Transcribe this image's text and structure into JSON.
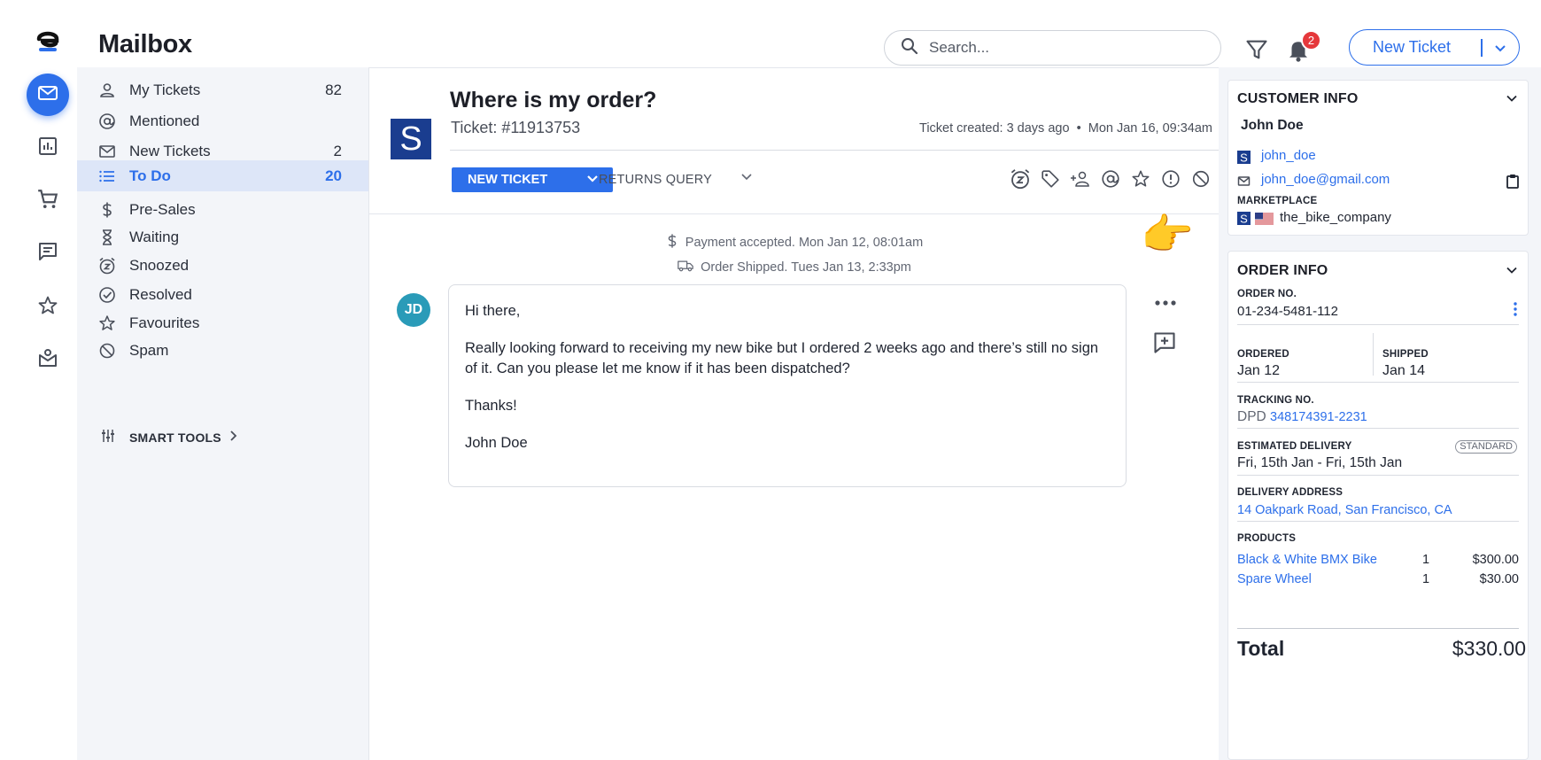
{
  "app": {
    "title": "Mailbox",
    "brand_color": "#2d6fea",
    "logo_icon": "brand-e-logo"
  },
  "rail": {
    "items": [
      {
        "icon": "mail-icon",
        "active": true
      },
      {
        "icon": "analytics-icon",
        "active": false
      },
      {
        "icon": "cart-icon",
        "active": false
      },
      {
        "icon": "chat-icon",
        "active": false
      },
      {
        "icon": "star-icon",
        "active": false
      },
      {
        "icon": "inbox-user-icon",
        "active": false
      }
    ]
  },
  "header": {
    "search_placeholder": "Search...",
    "notification_count": "2",
    "new_ticket_label": "New Ticket"
  },
  "nav": {
    "items": [
      {
        "label": "My Tickets",
        "count": "82",
        "icon": "user-icon"
      },
      {
        "label": "Mentioned",
        "count": "",
        "icon": "at-icon"
      },
      {
        "label": "New Tickets",
        "count": "2",
        "icon": "envelope-icon"
      },
      {
        "label": "To Do",
        "count": "20",
        "icon": "list-icon",
        "active": true
      },
      {
        "label": "Pre-Sales",
        "count": "",
        "icon": "dollar-icon"
      },
      {
        "label": "Waiting",
        "count": "",
        "icon": "hourglass-icon"
      },
      {
        "label": "Snoozed",
        "count": "",
        "icon": "snooze-icon"
      },
      {
        "label": "Resolved",
        "count": "",
        "icon": "check-circle-icon"
      },
      {
        "label": "Favourites",
        "count": "",
        "icon": "star-icon"
      },
      {
        "label": "Spam",
        "count": "",
        "icon": "block-icon"
      }
    ],
    "smart_tools_label": "SMART TOOLS"
  },
  "ticket": {
    "store_logo_letter": "S",
    "subject": "Where is my order?",
    "number": "Ticket: #11913753",
    "created": "Ticket created: 3 days ago",
    "created_date": "Mon Jan 16, 09:34am",
    "status_label": "NEW TICKET",
    "tag_label": "RETURNS QUERY",
    "actions": [
      "snooze-icon",
      "tag-icon",
      "assign-user-icon",
      "mention-icon",
      "favourite-icon",
      "alert-icon",
      "spam-icon"
    ]
  },
  "timeline": {
    "events": [
      {
        "icon": "dollar-icon",
        "text": "Payment accepted. Mon Jan 12, 08:01am"
      },
      {
        "icon": "truck-icon",
        "text": "Order Shipped. Tues Jan 13, 2:33pm"
      }
    ]
  },
  "message": {
    "avatar_initials": "JD",
    "paragraphs": [
      "Hi there,",
      "Really looking forward to receiving my new bike but I ordered 2 weeks ago and there’s still no sign of it. Can you please let me know if it has been dispatched?",
      "Thanks!",
      "John Doe"
    ]
  },
  "customer_info": {
    "title": "CUSTOMER INFO",
    "name": "John Doe",
    "username": "john_doe",
    "email": "john_doe@gmail.com",
    "marketplace_label": "MARKETPLACE",
    "marketplace": "the_bike_company"
  },
  "order_info": {
    "title": "ORDER INFO",
    "order_no_label": "ORDER NO.",
    "order_no": "01-234-5481-112",
    "ordered_label": "ORDERED",
    "ordered": "Jan 12",
    "shipped_label": "SHIPPED",
    "shipped": "Jan 14",
    "tracking_label": "TRACKING NO.",
    "carrier": "DPD",
    "tracking_no": "348174391-2231",
    "est_delivery_label": "ESTIMATED DELIVERY",
    "est_delivery": "Fri, 15th Jan - Fri, 15th Jan",
    "shipping_type": "STANDARD",
    "address_label": "DELIVERY ADDRESS",
    "address": "14 Oakpark Road, San Francisco, CA",
    "products_label": "PRODUCTS",
    "products": [
      {
        "name": "Black & White BMX Bike",
        "qty": "1",
        "price": "$300.00"
      },
      {
        "name": "Spare Wheel",
        "qty": "1",
        "price": "$30.00"
      }
    ],
    "total_label": "Total",
    "total": "$330.00"
  }
}
